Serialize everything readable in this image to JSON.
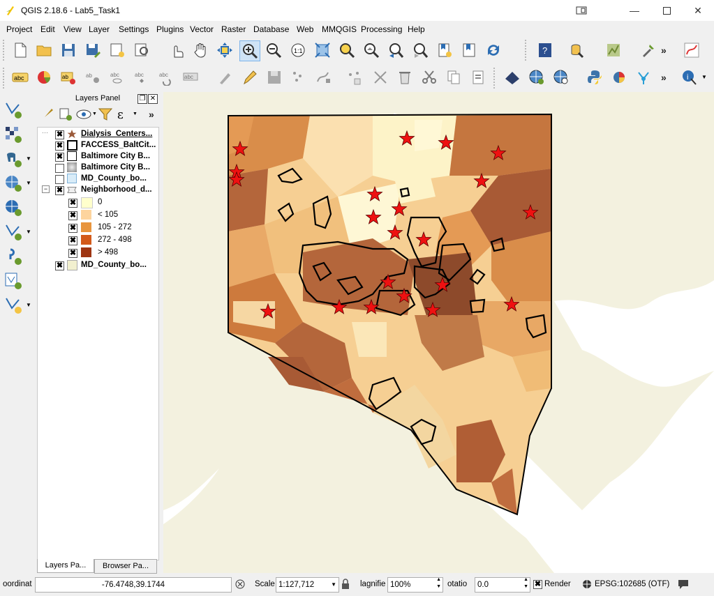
{
  "window": {
    "title": "QGIS 2.18.6 - Lab5_Task1"
  },
  "menu": [
    "Project",
    "Edit",
    "View",
    "Layer",
    "Settings",
    "Plugins",
    "Vector",
    "Raster",
    "Database",
    "Web",
    "MMQGIS",
    "Processing",
    "Help"
  ],
  "layers_panel": {
    "title": "Layers Panel",
    "layers": [
      {
        "name": "Dialysis_Centers...",
        "checked": true
      },
      {
        "name": "FACCESS_BaltCit...",
        "checked": true
      },
      {
        "name": "Baltimore City B...",
        "checked": true
      },
      {
        "name": "Baltimore City B...",
        "checked": false
      },
      {
        "name": "MD_County_bo...",
        "checked": false
      },
      {
        "name": "Neighborhood_d...",
        "checked": true
      },
      {
        "name": "MD_County_bo...",
        "checked": true
      }
    ],
    "legend": [
      {
        "label": "0",
        "color": "#ffffcc"
      },
      {
        "label": "< 105",
        "color": "#fdd49e"
      },
      {
        "label": "105 - 272",
        "color": "#e8953e"
      },
      {
        "label": "272 - 498",
        "color": "#d35a1a"
      },
      {
        "label": "> 498",
        "color": "#9e3512"
      }
    ],
    "tabs": [
      "Layers Pa...",
      "Browser Pa..."
    ]
  },
  "status": {
    "coordinate_label": "oordinat",
    "coordinate": "-76.4748,39.1744",
    "scale_label": "Scale",
    "scale": "1:127,712",
    "magnifier_label": "lagnifie",
    "magnifier": "100%",
    "rotation_label": "otatio",
    "rotation": "0.0",
    "render_label": "Render",
    "crs": "EPSG:102685 (OTF)"
  },
  "map": {
    "water_color": "#ffffff",
    "land_color": "#eeeecb",
    "star_color": "#ee1111"
  }
}
